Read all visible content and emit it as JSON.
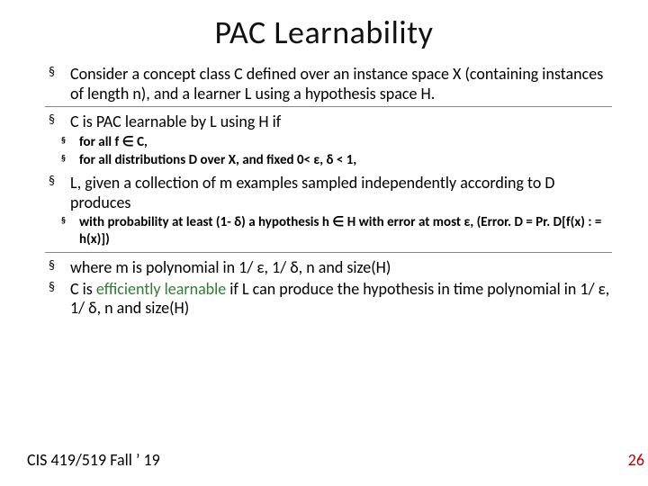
{
  "title": "PAC Learnability",
  "bullets": {
    "b1": "Consider a  concept class C defined over an instance space X (containing instances of length n),  and a learner L using a hypothesis space H.",
    "b2": " C is PAC learnable by L using H if",
    "b2s1": "for all f ∈ C,",
    "b2s2": "for all distributions D  over X,  and fixed 0< ε, δ < 1,",
    "b3": "L, given a collection of m examples sampled independently according to D produces",
    "b3s1": "with probability at least (1- δ) a hypothesis h ∈ H with error at most ε, (Error. D = Pr. D[f(x) : = h(x)])",
    "b4": "where m is polynomial in 1/ ε, 1/ δ, n and size(H)",
    "b5_pre": "C is ",
    "b5_green": "efficiently learnable",
    "b5_post": " if L can produce the hypothesis in time polynomial in 1/ ε, 1/ δ, n and size(H)"
  },
  "footer": {
    "left": "CIS 419/519 Fall ’ 19",
    "right": "26"
  }
}
